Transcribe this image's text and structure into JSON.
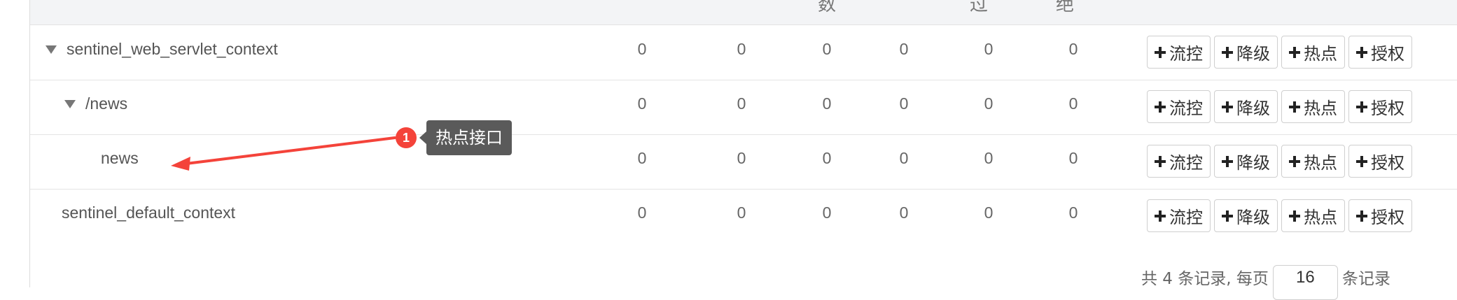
{
  "header": {
    "partial_labels": [
      "数",
      "过",
      "绝"
    ]
  },
  "rows": [
    {
      "name": "sentinel_web_servlet_context",
      "values": [
        "0",
        "0",
        "0",
        "0",
        "0",
        "0"
      ],
      "expanded": true
    },
    {
      "name": "/news",
      "values": [
        "0",
        "0",
        "0",
        "0",
        "0",
        "0"
      ],
      "expanded": true
    },
    {
      "name": "news",
      "values": [
        "0",
        "0",
        "0",
        "0",
        "0",
        "0"
      ]
    },
    {
      "name": "sentinel_default_context",
      "values": [
        "0",
        "0",
        "0",
        "0",
        "0",
        "0"
      ]
    }
  ],
  "actions": {
    "flow": "流控",
    "degrade": "降级",
    "hot": "热点",
    "auth": "授权"
  },
  "footer": {
    "prefix": "共 4 条记录, 每页",
    "page_size": "16",
    "suffix": "条记录"
  },
  "annotation": {
    "badge": "1",
    "tooltip": "热点接口",
    "color": "#f4433a"
  }
}
